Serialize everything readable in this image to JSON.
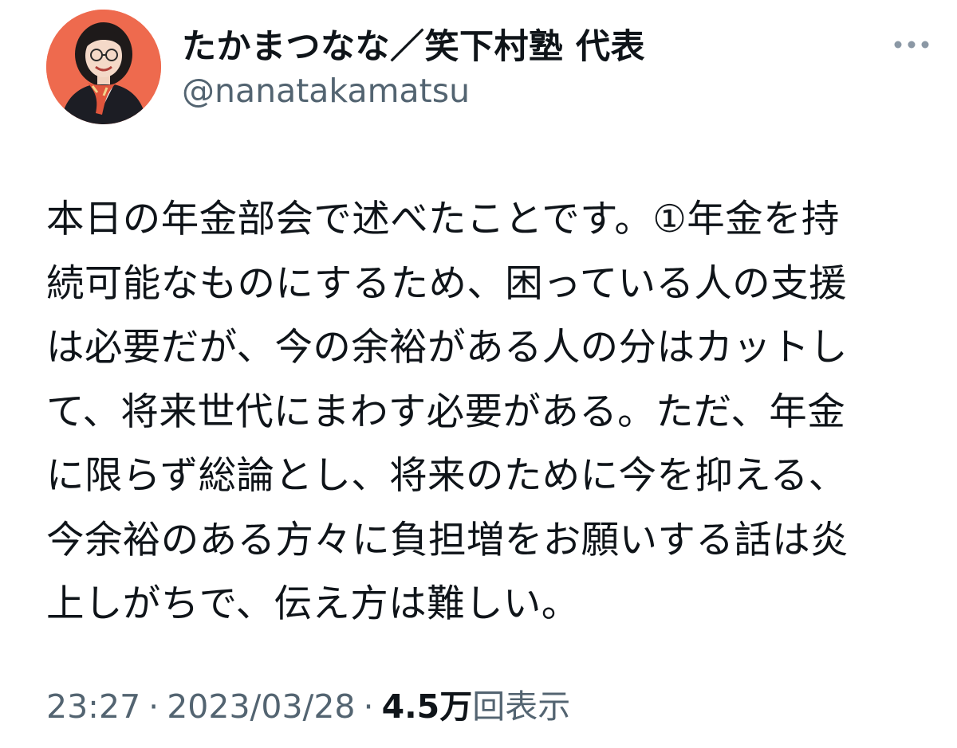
{
  "author": {
    "display_name": "たかまつなな／笑下村塾 代表",
    "handle": "@nanatakamatsu",
    "avatar_icon": "profile-photo-avatar"
  },
  "more_icon": "more-dots-icon",
  "tweet": {
    "lines": [
      "本日の年金部会で述べたことです。①年金を持",
      "続可能なものにするため、困っている人の支援",
      "は必要だが、今の余裕がある人の分はカットし",
      "て、将来世代にまわす必要がある。ただ、年金",
      "に限らず総論とし、将来のために今を抑える、",
      "今余裕のある方々に負担増をお願いする話は炎",
      "上しがちで、伝え方は難しい。"
    ]
  },
  "meta": {
    "time": "23:27",
    "separator": "·",
    "date": "2023/03/28",
    "views_count": "4.5万",
    "views_label": "回表示"
  },
  "colors": {
    "text_primary": "#0f1419",
    "text_secondary": "#536471",
    "avatar_background": "#ee6a4e"
  }
}
